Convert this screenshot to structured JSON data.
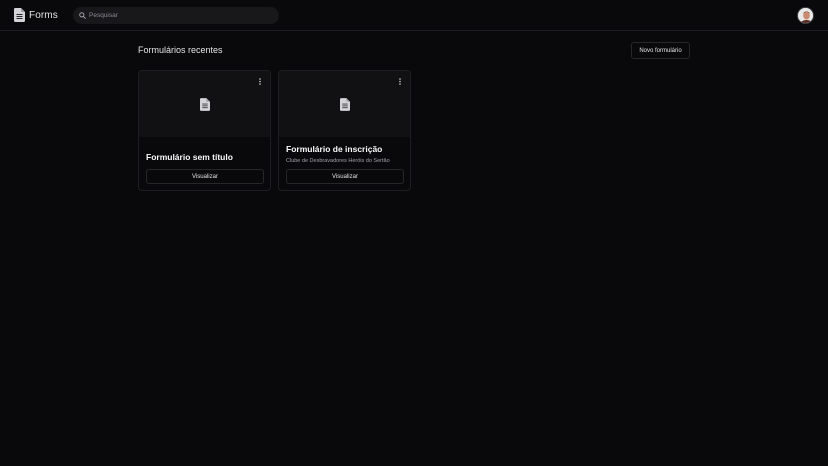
{
  "app": {
    "name": "Forms"
  },
  "search": {
    "placeholder": "Pesquisar",
    "value": ""
  },
  "main": {
    "section_title": "Formulários recentes",
    "new_form_label": "Novo formulário"
  },
  "forms": [
    {
      "title": "Formulário sem título",
      "subtitle": "",
      "view_label": "Visualizar"
    },
    {
      "title": "Formulário de inscrição",
      "subtitle": "Clube de Desbravadores Heróis do Sertão",
      "view_label": "Visualizar"
    }
  ],
  "icons": {
    "logo": "document-icon",
    "search": "search-icon",
    "card_menu": "more-vertical-icon",
    "card_preview": "document-icon"
  },
  "colors": {
    "background": "#09090b",
    "surface": "#111113",
    "border": "#27272a",
    "text": "#fafafa",
    "muted": "#a1a1aa"
  }
}
